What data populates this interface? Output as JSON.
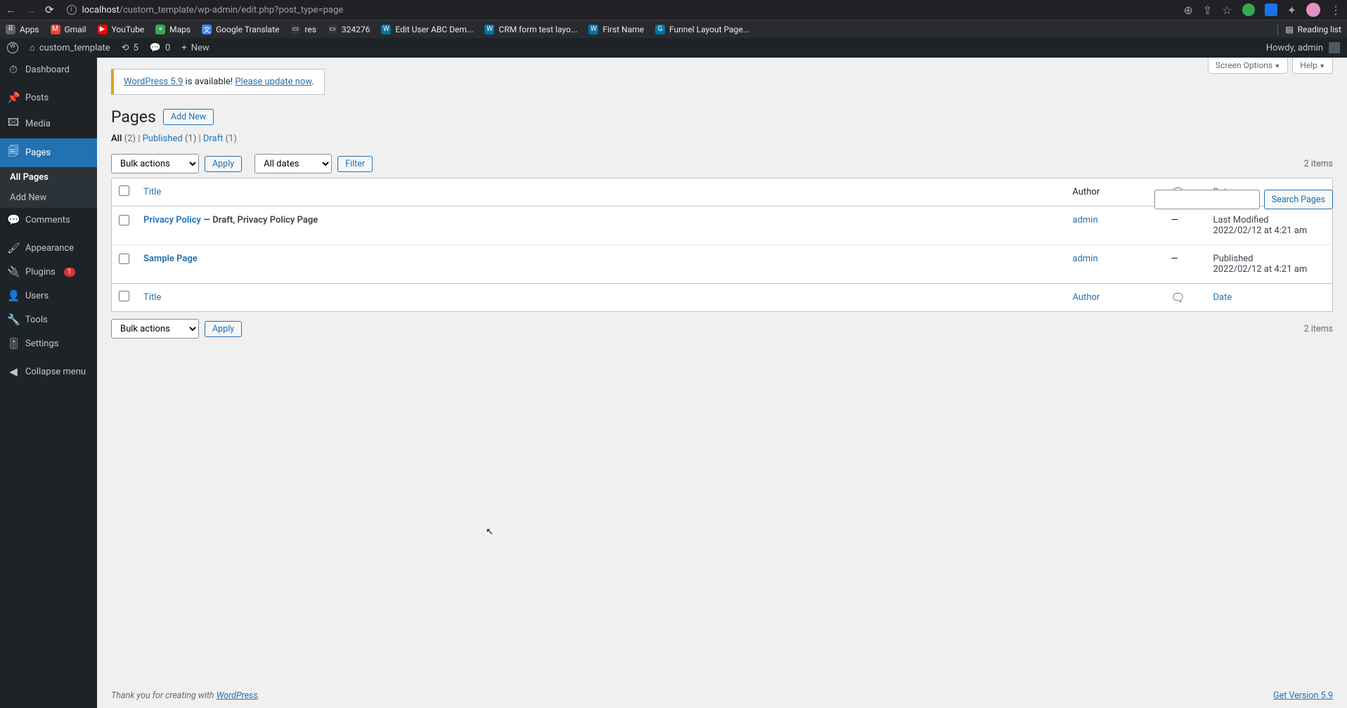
{
  "browser": {
    "url_host": "localhost",
    "url_path": "/custom_template/wp-admin/edit.php?post_type=page",
    "reading_list": "Reading list"
  },
  "bookmarks": [
    {
      "label": "Apps",
      "color": "#5f6368"
    },
    {
      "label": "Gmail",
      "color": "#ea4335"
    },
    {
      "label": "YouTube",
      "color": "#ff0000"
    },
    {
      "label": "Maps",
      "color": "#4285f4"
    },
    {
      "label": "Google Translate",
      "color": "#4285f4"
    },
    {
      "label": "res",
      "color": "#333"
    },
    {
      "label": "324276",
      "color": "#333"
    },
    {
      "label": "Edit User ABC Dem...",
      "color": "#0073aa"
    },
    {
      "label": "CRM form test layo...",
      "color": "#0073aa"
    },
    {
      "label": "First Name",
      "color": "#0073aa"
    },
    {
      "label": "Funnel Layout Page...",
      "color": "#0073aa"
    }
  ],
  "adminbar": {
    "site_name": "custom_template",
    "updates": "5",
    "comments": "0",
    "new": "New",
    "howdy": "Howdy, admin"
  },
  "sidebar": {
    "dashboard": "Dashboard",
    "posts": "Posts",
    "media": "Media",
    "pages": "Pages",
    "all_pages": "All Pages",
    "add_new": "Add New",
    "comments": "Comments",
    "appearance": "Appearance",
    "plugins": "Plugins",
    "plugins_count": "1",
    "users": "Users",
    "tools": "Tools",
    "settings": "Settings",
    "collapse": "Collapse menu"
  },
  "screen_meta": {
    "screen_options": "Screen Options",
    "help": "Help"
  },
  "update_nag": {
    "link1": "WordPress 5.9",
    "middle": " is available! ",
    "link2": "Please update now",
    "end": "."
  },
  "header": {
    "title": "Pages",
    "add_new": "Add New"
  },
  "filters": {
    "all_label": "All",
    "all_count": "(2)",
    "published_label": "Published",
    "published_count": "(1)",
    "draft_label": "Draft",
    "draft_count": "(1)",
    "bulk_actions": "Bulk actions",
    "apply": "Apply",
    "all_dates": "All dates",
    "filter": "Filter",
    "items_count": "2 items"
  },
  "search": {
    "button": "Search Pages"
  },
  "table": {
    "col_title": "Title",
    "col_author": "Author",
    "col_date": "Date",
    "rows": [
      {
        "title": "Privacy Policy",
        "state": " — Draft, Privacy Policy Page",
        "author": "admin",
        "comments": "—",
        "date_label": "Last Modified",
        "date_value": "2022/02/12 at 4:21 am"
      },
      {
        "title": "Sample Page",
        "state": "",
        "author": "admin",
        "comments": "—",
        "date_label": "Published",
        "date_value": "2022/02/12 at 4:21 am"
      }
    ]
  },
  "footer": {
    "thank_you_pre": "Thank you for creating with ",
    "wordpress": "WordPress",
    "thank_you_post": ".",
    "get_version": "Get Version 5.9"
  }
}
